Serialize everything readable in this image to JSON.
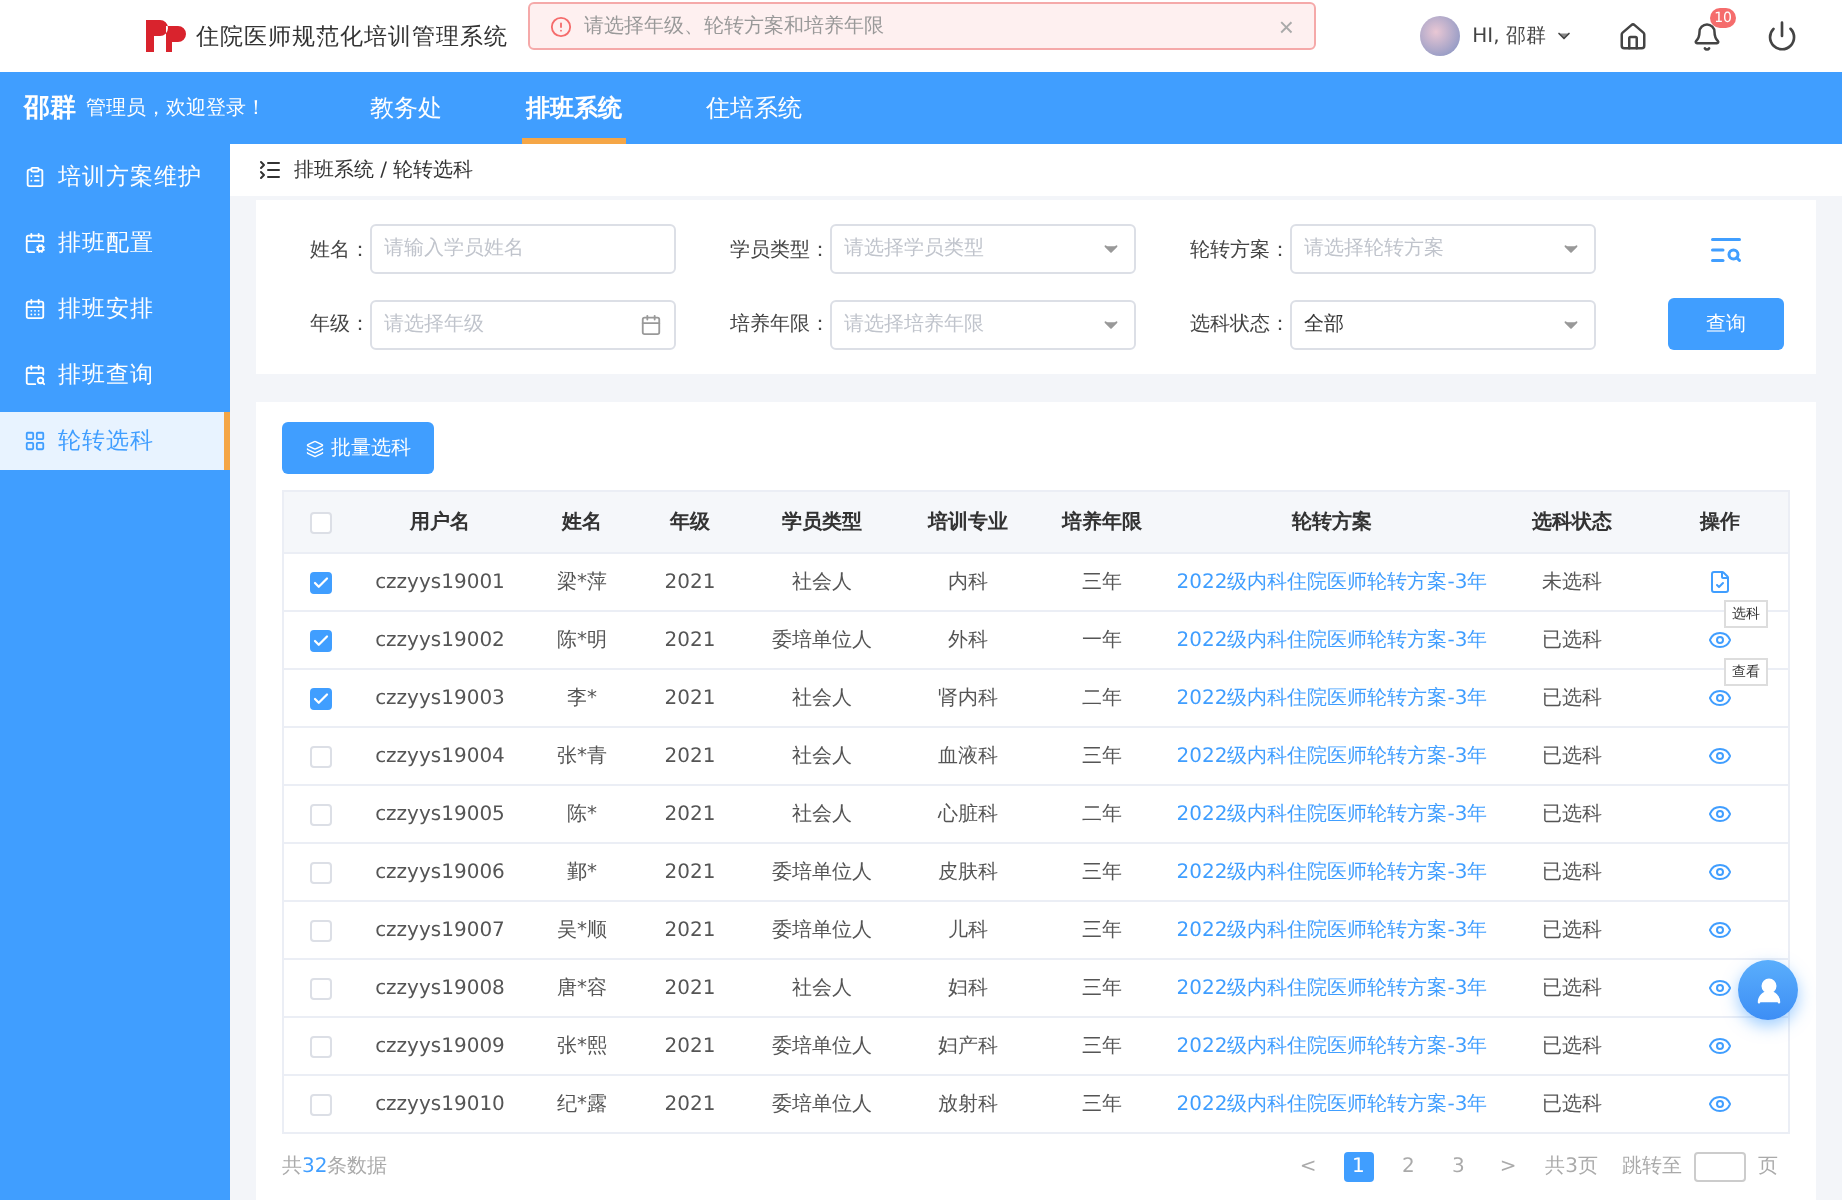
{
  "header": {
    "title": "住院医师规范化培训管理系统",
    "alert": {
      "message": "请选择年级、轮转方案和培养年限",
      "close": "×"
    },
    "user": {
      "greeting": "HI,",
      "name": "邵群"
    },
    "notifications": {
      "badge": "10"
    }
  },
  "nav": {
    "user_name": "邵群",
    "welcome": "管理员，欢迎登录！",
    "tabs": [
      {
        "label": "教务处",
        "selected": false
      },
      {
        "label": "排班系统",
        "selected": true
      },
      {
        "label": "住培系统",
        "selected": false
      }
    ]
  },
  "sidebar": {
    "items": [
      {
        "label": "培训方案维护",
        "selected": false
      },
      {
        "label": "排班配置",
        "selected": false
      },
      {
        "label": "排班安排",
        "selected": false
      },
      {
        "label": "排班查询",
        "selected": false
      },
      {
        "label": "轮转选科",
        "selected": true
      }
    ]
  },
  "breadcrumb": "排班系统 / 轮转选科",
  "filters": [
    {
      "kind": "text",
      "label": "姓名：",
      "placeholder": "请输入学员姓名"
    },
    {
      "kind": "select",
      "label": "学员类型：",
      "placeholder": "请选择学员类型"
    },
    {
      "kind": "select",
      "label": "轮转方案：",
      "placeholder": "请选择轮转方案"
    },
    {
      "kind": "date",
      "label": "年级：",
      "placeholder": "请选择年级"
    },
    {
      "kind": "select",
      "label": "培养年限：",
      "placeholder": "请选择培养年限"
    },
    {
      "kind": "select",
      "label": "选科状态：",
      "value": "全部"
    }
  ],
  "query_button": "查询",
  "batch_button": "批量选科",
  "table": {
    "all_checked": false,
    "columns": [
      "用户名",
      "姓名",
      "年级",
      "学员类型",
      "培训专业",
      "培养年限",
      "轮转方案",
      "选科状态",
      "操作"
    ],
    "rows": [
      {
        "checked": true,
        "cells": [
          "czzyys19001",
          "梁*萍",
          "2021",
          "社会人",
          "内科",
          "三年",
          "2022级内科住院医师轮转方案-3年",
          "未选科"
        ],
        "action": {
          "kind": "select"
        },
        "tooltip": "选科"
      },
      {
        "checked": true,
        "cells": [
          "czzyys19002",
          "陈*明",
          "2021",
          "委培单位人",
          "外科",
          "一年",
          "2022级内科住院医师轮转方案-3年",
          "已选科"
        ],
        "action": {
          "kind": "view"
        },
        "tooltip": "查看"
      },
      {
        "checked": true,
        "cells": [
          "czzyys19003",
          "李*",
          "2021",
          "社会人",
          "肾内科",
          "二年",
          "2022级内科住院医师轮转方案-3年",
          "已选科"
        ],
        "action": {
          "kind": "view"
        }
      },
      {
        "checked": false,
        "cells": [
          "czzyys19004",
          "张*青",
          "2021",
          "社会人",
          "血液科",
          "三年",
          "2022级内科住院医师轮转方案-3年",
          "已选科"
        ],
        "action": {
          "kind": "view"
        }
      },
      {
        "checked": false,
        "cells": [
          "czzyys19005",
          "陈*",
          "2021",
          "社会人",
          "心脏科",
          "二年",
          "2022级内科住院医师轮转方案-3年",
          "已选科"
        ],
        "action": {
          "kind": "view"
        }
      },
      {
        "checked": false,
        "cells": [
          "czzyys19006",
          "鄞*",
          "2021",
          "委培单位人",
          "皮肤科",
          "三年",
          "2022级内科住院医师轮转方案-3年",
          "已选科"
        ],
        "action": {
          "kind": "view"
        }
      },
      {
        "checked": false,
        "cells": [
          "czzyys19007",
          "吴*顺",
          "2021",
          "委培单位人",
          "儿科",
          "三年",
          "2022级内科住院医师轮转方案-3年",
          "已选科"
        ],
        "action": {
          "kind": "view"
        }
      },
      {
        "checked": false,
        "cells": [
          "czzyys19008",
          "唐*容",
          "2021",
          "社会人",
          "妇科",
          "三年",
          "2022级内科住院医师轮转方案-3年",
          "已选科"
        ],
        "action": {
          "kind": "view"
        }
      },
      {
        "checked": false,
        "cells": [
          "czzyys19009",
          "张*熙",
          "2021",
          "委培单位人",
          "妇产科",
          "三年",
          "2022级内科住院医师轮转方案-3年",
          "已选科"
        ],
        "action": {
          "kind": "view"
        }
      },
      {
        "checked": false,
        "cells": [
          "czzyys19010",
          "纪*露",
          "2021",
          "委培单位人",
          "放射科",
          "三年",
          "2022级内科住院医师轮转方案-3年",
          "已选科"
        ],
        "action": {
          "kind": "view"
        }
      }
    ]
  },
  "pagination": {
    "total_prefix": "共",
    "total": "32",
    "total_suffix": "条数据",
    "prev": "<",
    "pages": [
      {
        "label": "1",
        "selected": true
      },
      {
        "label": "2",
        "selected": false
      },
      {
        "label": "3",
        "selected": false
      }
    ],
    "next": ">",
    "page_count": "共3页",
    "jump_label": "跳转至",
    "jump_suffix": "页"
  }
}
